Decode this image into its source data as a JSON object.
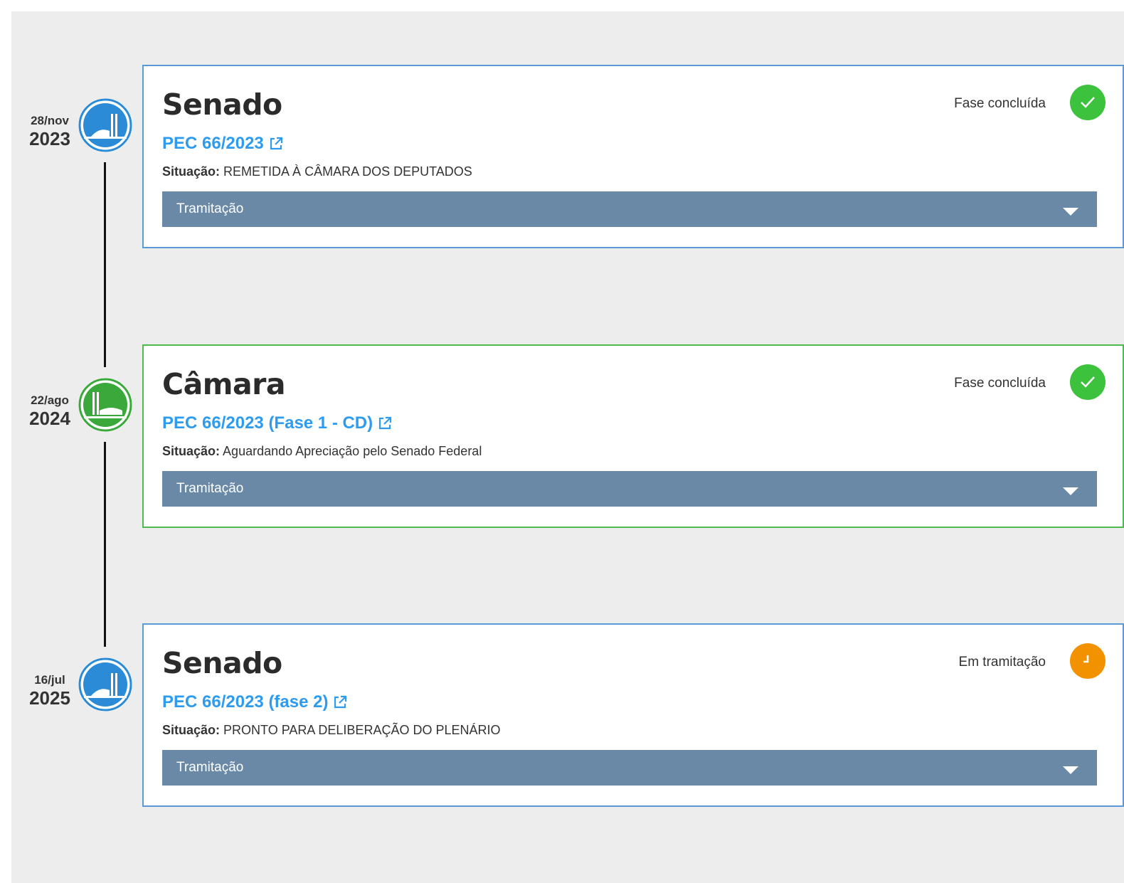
{
  "timeline": [
    {
      "date_day_month": "28/nov",
      "date_year": "2023",
      "house": "Senado",
      "node_icon": "senado-dome-icon",
      "node_color": "#2b8bd6",
      "link_text": "PEC 66/2023",
      "situation_label": "Situação:",
      "situation_value": "REMETIDA À CÂMARA DOS DEPUTADOS",
      "status_text": "Fase concluída",
      "status_icon": "check-icon",
      "status_color": "#3dc23d",
      "accordion_label": "Tramitação"
    },
    {
      "date_day_month": "22/ago",
      "date_year": "2024",
      "house": "Câmara",
      "node_icon": "camara-building-icon",
      "node_color": "#3aa83a",
      "link_text": "PEC 66/2023 (Fase 1 - CD)",
      "situation_label": "Situação:",
      "situation_value": "Aguardando Apreciação pelo Senado Federal",
      "status_text": "Fase concluída",
      "status_icon": "check-icon",
      "status_color": "#3dc23d",
      "accordion_label": "Tramitação"
    },
    {
      "date_day_month": "16/jul",
      "date_year": "2025",
      "house": "Senado",
      "node_icon": "senado-dome-icon",
      "node_color": "#2b8bd6",
      "link_text": "PEC 66/2023 (fase 2)",
      "situation_label": "Situação:",
      "situation_value": "PRONTO PARA DELIBERAÇÃO DO PLENÁRIO",
      "status_text": "Em tramitação",
      "status_icon": "clock-icon",
      "status_color": "#f39200",
      "accordion_label": "Tramitação"
    }
  ],
  "colors": {
    "panel_bg": "#ededed",
    "link": "#2d9cf0",
    "accordion_bg": "#6a89a6"
  }
}
